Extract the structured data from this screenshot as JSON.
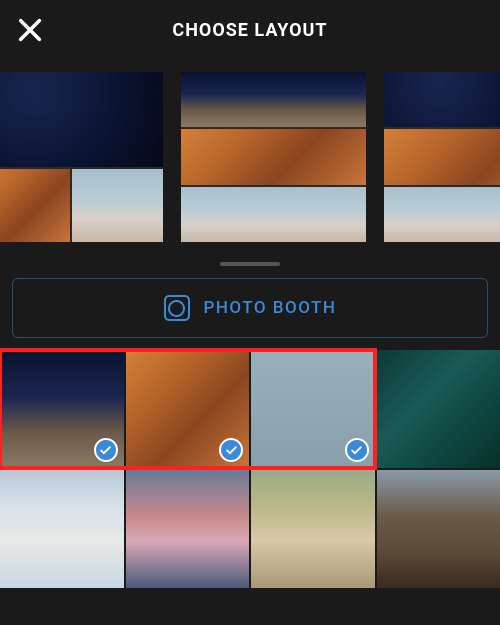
{
  "header": {
    "title": "CHOOSE LAYOUT"
  },
  "icons": {
    "close": "close-icon",
    "camera": "camera-icon",
    "check": "check-icon"
  },
  "photo_booth": {
    "label": "PHOTO BOOTH"
  },
  "layouts": [
    {
      "id": "layout-1",
      "rows": [
        [
          "stars"
        ],
        [
          "canyon",
          "blossom"
        ]
      ]
    },
    {
      "id": "layout-2",
      "rows": [
        [
          "stars-rock"
        ],
        [
          "canyon"
        ],
        [
          "blossom"
        ]
      ]
    },
    {
      "id": "layout-3",
      "rows": [
        [
          "stars"
        ],
        [
          "canyon"
        ],
        [
          "blossom"
        ]
      ]
    }
  ],
  "photos": [
    {
      "id": "stars-rock",
      "selected": true
    },
    {
      "id": "canyon",
      "selected": true
    },
    {
      "id": "lightblue",
      "selected": true
    },
    {
      "id": "ocean",
      "selected": false
    },
    {
      "id": "mountain",
      "selected": false
    },
    {
      "id": "sunset",
      "selected": false
    },
    {
      "id": "house",
      "selected": false
    },
    {
      "id": "cliff",
      "selected": false
    }
  ],
  "highlight": {
    "covers_first_n": 3
  },
  "colors": {
    "accent": "#3a8ad8",
    "highlight": "#ff2020",
    "background": "#1a1a1a"
  }
}
